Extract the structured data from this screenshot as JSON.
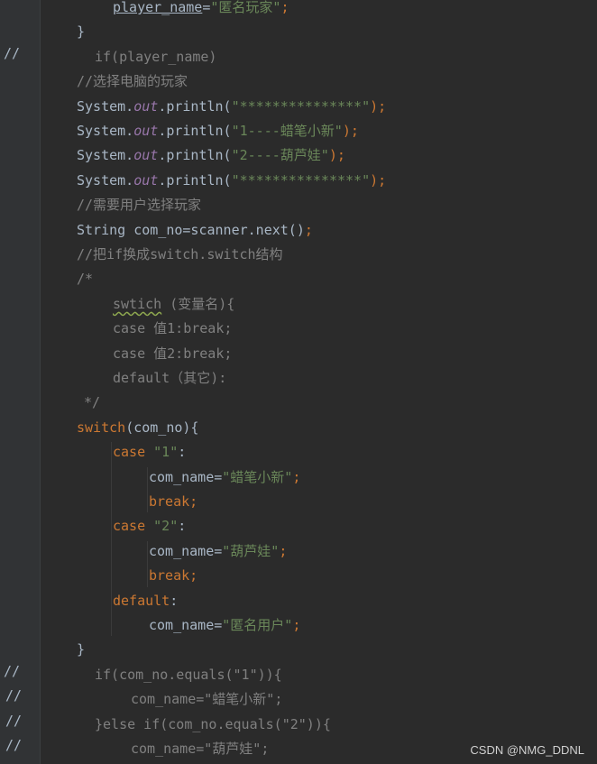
{
  "lines": [
    {
      "segs": [
        [
          "player_name",
          "ul"
        ],
        [
          "=",
          ""
        ],
        [
          "\"匿名玩家\"",
          "str"
        ],
        [
          ";",
          "kw"
        ]
      ]
    },
    {
      "segs": [
        [
          "}",
          ""
        ]
      ]
    },
    {
      "segs": [
        [
          "if(player_name)",
          "cm"
        ]
      ]
    },
    {
      "segs": [
        [
          "//选择电脑的玩家",
          "cm"
        ]
      ]
    },
    {
      "segs": [
        [
          "System.",
          ""
        ],
        [
          "out",
          "fld"
        ],
        [
          ".println(",
          ""
        ],
        [
          "\"***************\"",
          "str"
        ],
        [
          ");",
          "kw"
        ]
      ]
    },
    {
      "segs": [
        [
          "System.",
          ""
        ],
        [
          "out",
          "fld"
        ],
        [
          ".println(",
          ""
        ],
        [
          "\"1----蜡笔小新\"",
          "str"
        ],
        [
          ");",
          "kw"
        ]
      ]
    },
    {
      "segs": [
        [
          "System.",
          ""
        ],
        [
          "out",
          "fld"
        ],
        [
          ".println(",
          ""
        ],
        [
          "\"2----葫芦娃\"",
          "str"
        ],
        [
          ");",
          "kw"
        ]
      ]
    },
    {
      "segs": [
        [
          "System.",
          ""
        ],
        [
          "out",
          "fld"
        ],
        [
          ".println(",
          ""
        ],
        [
          "\"***************\"",
          "str"
        ],
        [
          ");",
          "kw"
        ]
      ]
    },
    {
      "segs": [
        [
          "//需要用户选择玩家",
          "cm"
        ]
      ]
    },
    {
      "segs": [
        [
          "String com_no=scanner.next()",
          ""
        ],
        [
          ";",
          "kw"
        ]
      ]
    },
    {
      "segs": [
        [
          "//把if换成switch.switch结构",
          "cm"
        ]
      ]
    },
    {
      "segs": [
        [
          "/*",
          "cm"
        ]
      ]
    },
    {
      "segs": [
        [
          "swtich",
          "cm wavy"
        ],
        [
          " (变量名){",
          "cm"
        ]
      ]
    },
    {
      "segs": [
        [
          "case 值1:break;",
          "cm"
        ]
      ]
    },
    {
      "segs": [
        [
          "case 值2:break;",
          "cm"
        ]
      ]
    },
    {
      "segs": [
        [
          "default（其它):",
          "cm"
        ]
      ]
    },
    {
      "segs": [
        [
          "*/",
          "cm"
        ]
      ]
    },
    {
      "segs": [
        [
          "switch",
          "kw"
        ],
        [
          "(com_no){",
          ""
        ]
      ]
    },
    {
      "segs": [
        [
          "case ",
          "kw"
        ],
        [
          "\"1\"",
          "str"
        ],
        [
          ":",
          ""
        ]
      ]
    },
    {
      "segs": [
        [
          "com_name=",
          ""
        ],
        [
          "\"蜡笔小新\"",
          "str"
        ],
        [
          ";",
          "kw"
        ]
      ]
    },
    {
      "segs": [
        [
          "break;",
          "kw"
        ]
      ]
    },
    {
      "segs": [
        [
          "case ",
          "kw"
        ],
        [
          "\"2\"",
          "str"
        ],
        [
          ":",
          ""
        ]
      ]
    },
    {
      "segs": [
        [
          "com_name=",
          ""
        ],
        [
          "\"葫芦娃\"",
          "str"
        ],
        [
          ";",
          "kw"
        ]
      ]
    },
    {
      "segs": [
        [
          "break;",
          "kw"
        ]
      ]
    },
    {
      "segs": [
        [
          "default",
          "kw"
        ],
        [
          ":",
          ""
        ]
      ]
    },
    {
      "segs": [
        [
          "com_name=",
          ""
        ],
        [
          "\"匿名用户\"",
          "str"
        ],
        [
          ";",
          "kw"
        ]
      ]
    },
    {
      "segs": [
        [
          "}",
          ""
        ]
      ]
    },
    {
      "segs": [
        [
          "if(com_no.equals(\"1\")){",
          "cm"
        ]
      ]
    },
    {
      "segs": [
        [
          "com_name=\"蜡笔小新\";",
          "cm"
        ]
      ]
    },
    {
      "segs": [
        [
          "}else if(com_no.equals(\"2\")){",
          "cm"
        ]
      ]
    },
    {
      "segs": [
        [
          "com_name=\"葫芦娃\";",
          "cm"
        ]
      ]
    }
  ],
  "gutter_marks": {
    "2": "//",
    "27": "//",
    "28": "//",
    "29": "//",
    "30": "//"
  },
  "watermark": "CSDN @NMG_DDNL",
  "colors": {
    "background": "#2b2b2b",
    "keyword": "#cc7832",
    "string": "#6a8759",
    "comment": "#808080",
    "field": "#9876aa",
    "text": "#a9b7c6"
  }
}
